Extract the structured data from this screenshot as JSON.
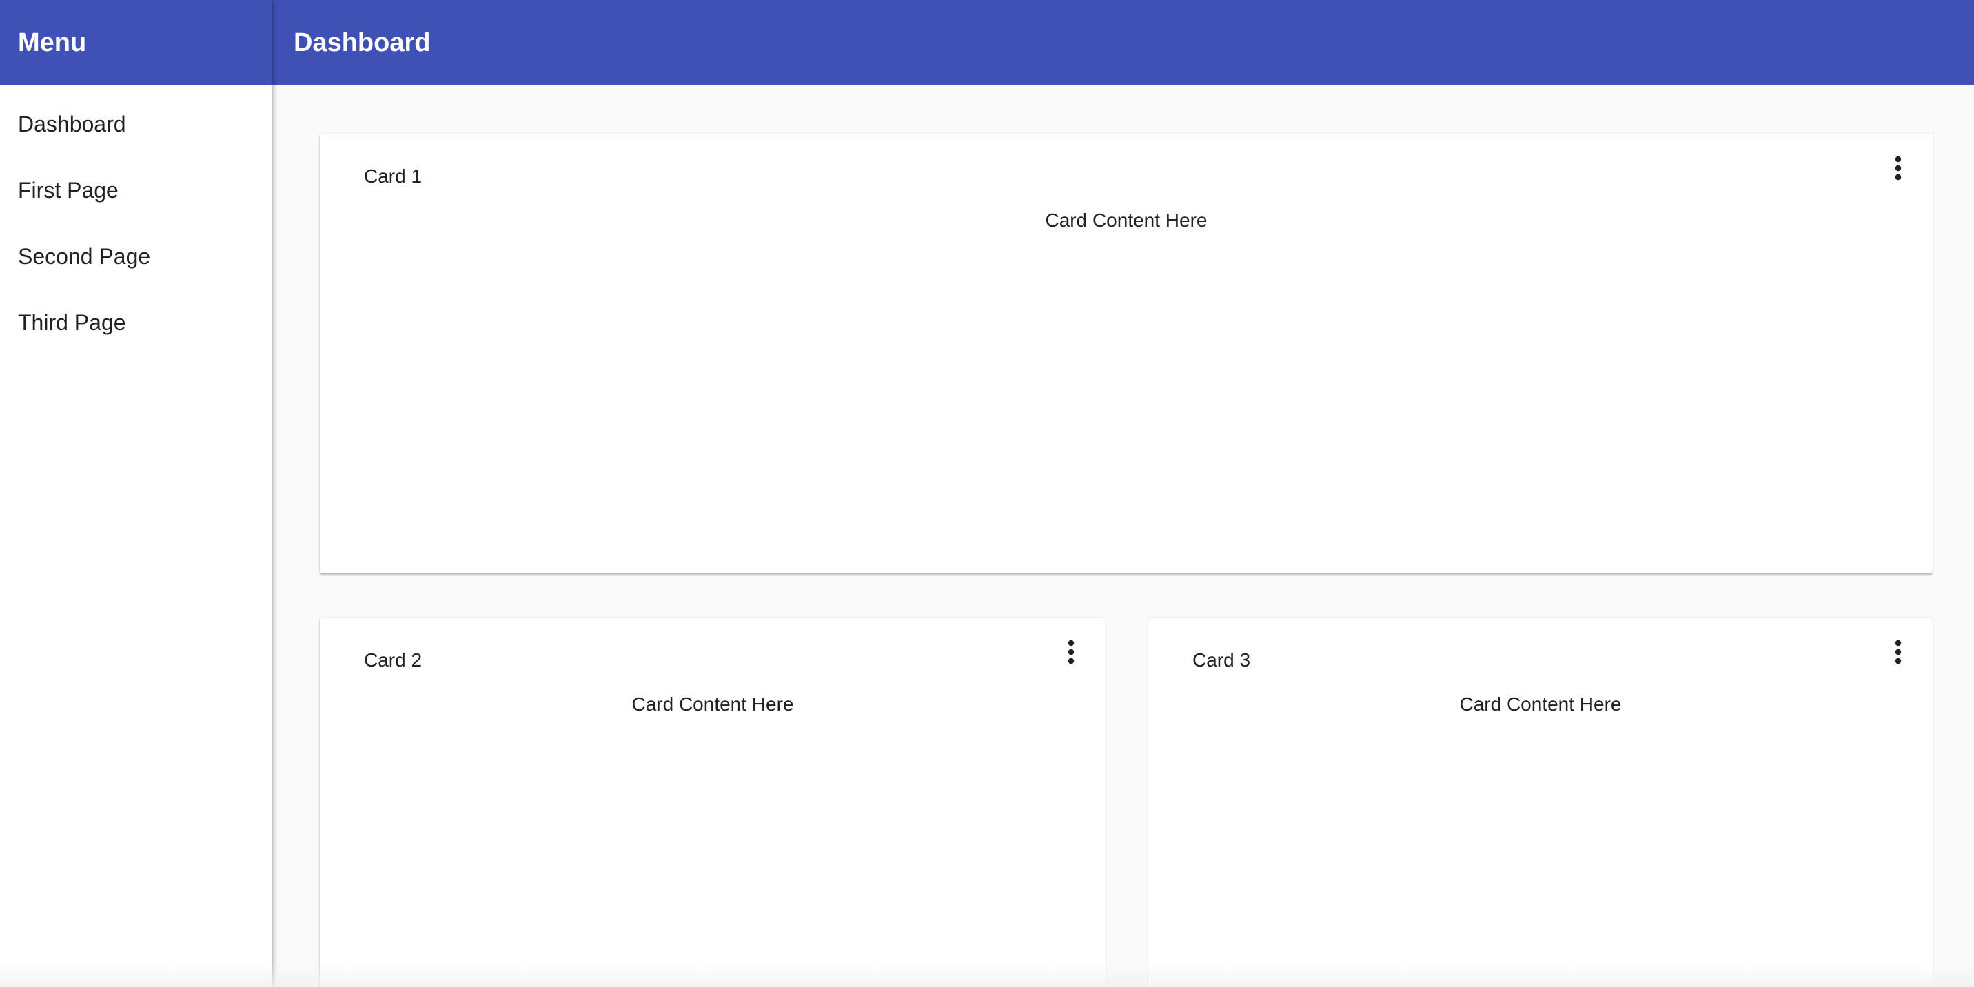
{
  "sidebar": {
    "title": "Menu",
    "items": [
      {
        "label": "Dashboard"
      },
      {
        "label": "First Page"
      },
      {
        "label": "Second Page"
      },
      {
        "label": "Third Page"
      }
    ]
  },
  "header": {
    "title": "Dashboard"
  },
  "cards": [
    {
      "title": "Card 1",
      "content": "Card Content Here",
      "menu_icon": "more-vert-icon"
    },
    {
      "title": "Card 2",
      "content": "Card Content Here",
      "menu_icon": "more-vert-icon"
    },
    {
      "title": "Card 3",
      "content": "Card Content Here",
      "menu_icon": "more-vert-icon"
    }
  ],
  "colors": {
    "primary": "#3f51b5",
    "background": "#fafafa",
    "surface": "#ffffff",
    "text": "#212121"
  }
}
